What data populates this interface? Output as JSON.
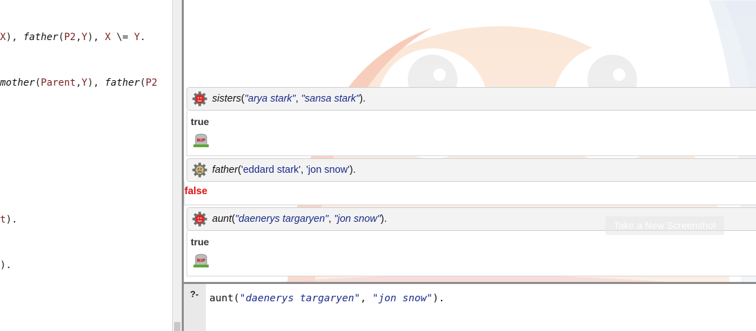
{
  "editor": {
    "lines": [
      {
        "segments": [
          {
            "t": "X",
            "c": "var"
          },
          {
            "t": "), ",
            "c": ""
          },
          {
            "t": "father",
            "c": "pred"
          },
          {
            "t": "(",
            "c": ""
          },
          {
            "t": "P2",
            "c": "var"
          },
          {
            "t": ",",
            "c": ""
          },
          {
            "t": "Y",
            "c": "var"
          },
          {
            "t": "), ",
            "c": ""
          },
          {
            "t": "X",
            "c": "var"
          },
          {
            "t": " \\= ",
            "c": ""
          },
          {
            "t": "Y",
            "c": "var"
          },
          {
            "t": ".",
            "c": ""
          }
        ]
      },
      {
        "segments": [
          {
            "t": "mother",
            "c": "pred"
          },
          {
            "t": "(",
            "c": ""
          },
          {
            "t": "Parent",
            "c": "var"
          },
          {
            "t": ",",
            "c": ""
          },
          {
            "t": "Y",
            "c": "var"
          },
          {
            "t": "), ",
            "c": ""
          },
          {
            "t": "father",
            "c": "pred"
          },
          {
            "t": "(",
            "c": ""
          },
          {
            "t": "P2",
            "c": "var"
          }
        ]
      },
      {
        "segments": [
          {
            "t": "t",
            "c": "var"
          },
          {
            "t": ").",
            "c": ""
          }
        ]
      },
      {
        "segments": [
          {
            "t": ").",
            "c": ""
          }
        ]
      }
    ]
  },
  "results": {
    "queries": [
      {
        "predicate": "sisters",
        "args": [
          {
            "text": "\"arya stark\"",
            "kind": "string"
          },
          {
            "text": "\"sansa stark\"",
            "kind": "string"
          }
        ],
        "icon": "gear-red-icon",
        "answer": "true",
        "has_rip": true
      },
      {
        "predicate": "father",
        "args": [
          {
            "text": "'eddard stark'",
            "kind": "atom"
          },
          {
            "text": "'jon snow'",
            "kind": "atom"
          }
        ],
        "icon": "gear-sad-icon",
        "answer": "false",
        "has_rip": false
      },
      {
        "predicate": "aunt",
        "args": [
          {
            "text": "\"daenerys targaryen\"",
            "kind": "string"
          },
          {
            "text": "\"jon snow\"",
            "kind": "string"
          }
        ],
        "icon": "gear-red-icon",
        "answer": "true",
        "has_rip": true
      }
    ],
    "rip_label": "RIP"
  },
  "screenshot_button": "Take a New Screenshot",
  "input": {
    "prompt": "?-",
    "prefix": "aunt(",
    "arg1": "\"daenerys targaryen\"",
    "sep": ", ",
    "arg2": "\"jon snow\"",
    "suffix": ")."
  },
  "colors": {
    "variable": "#7a1f1f",
    "string": "#1a2a8a",
    "false": "#e01010"
  }
}
